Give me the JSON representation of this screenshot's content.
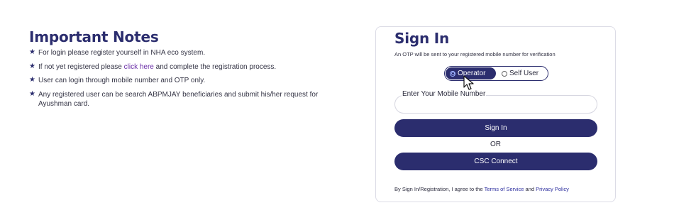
{
  "notes": {
    "title": "Important Notes",
    "items": [
      {
        "text": "For login please register yourself in NHA eco system."
      },
      {
        "text_before": "If not yet registered please ",
        "link": "click here",
        "text_after": " and complete the registration process."
      },
      {
        "text": "User can login through mobile number and OTP only."
      },
      {
        "text": "Any registered user can be search ABPMJAY beneficiaries and submit his/her request for Ayushman card."
      }
    ],
    "bullet_icon": "star-icon"
  },
  "signin": {
    "title": "Sign In",
    "subtitle": "An OTP will be sent to your registered mobile number for verification",
    "user_type": {
      "options": [
        "Operator",
        "Self User"
      ],
      "selected": "Operator"
    },
    "mobile": {
      "label": "Enter Your Mobile Number",
      "value": "",
      "placeholder": ""
    },
    "signin_button": "Sign In",
    "or_label": "OR",
    "csc_button": "CSC Connect",
    "terms": {
      "prefix": "By Sign In/Registration, I agree to the ",
      "terms_link": "Terms of Service",
      "and": " and ",
      "privacy_link": "Privacy Policy"
    }
  },
  "colors": {
    "brand": "#2b2d6e",
    "link": "#6b2fa8",
    "terms_link": "#2b2d9e"
  }
}
